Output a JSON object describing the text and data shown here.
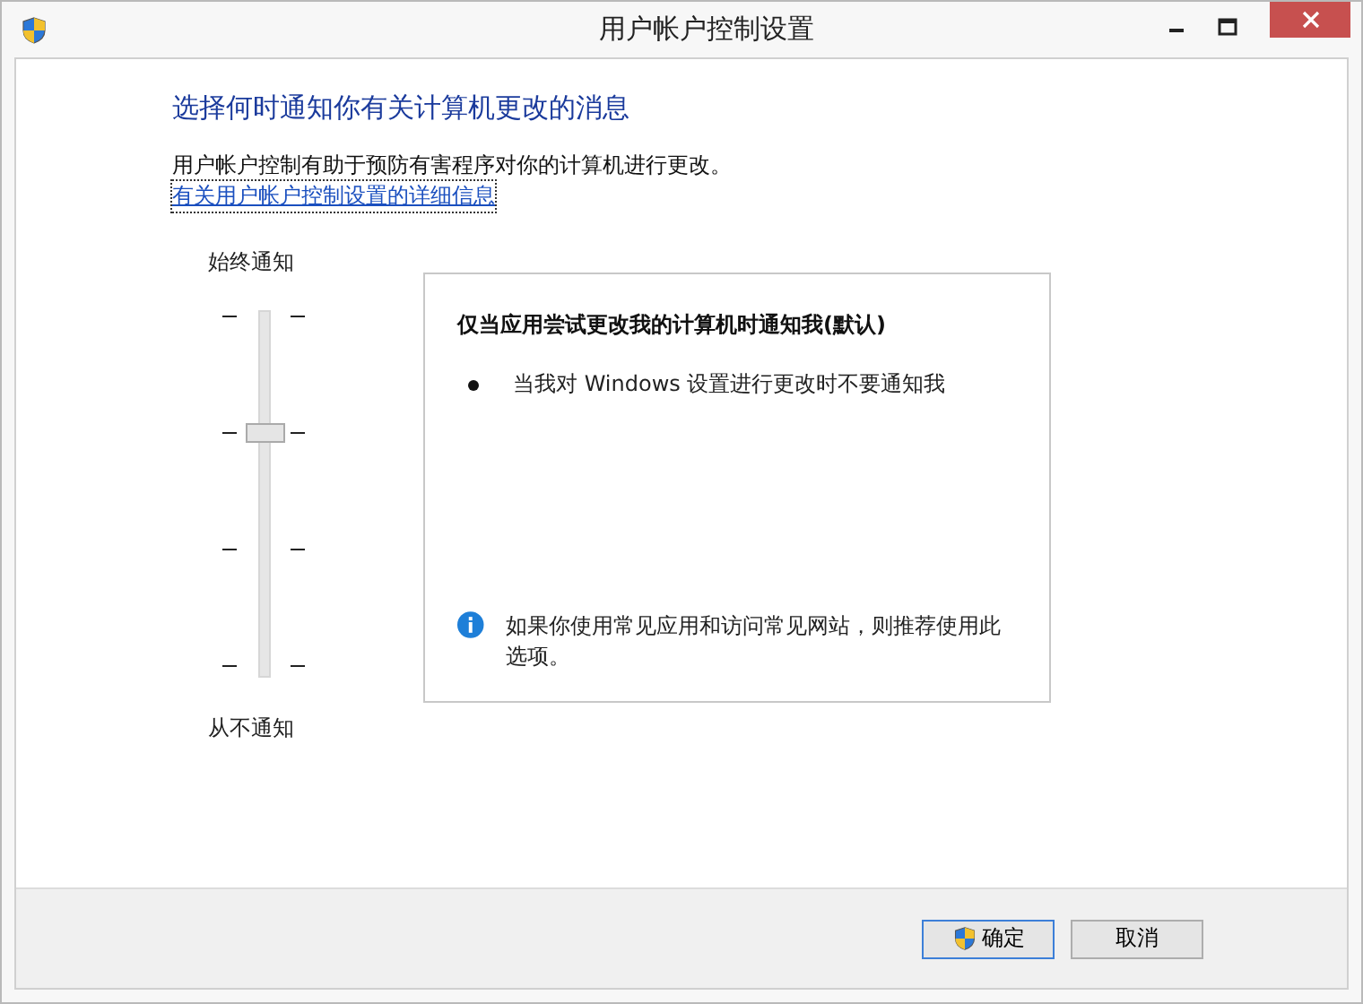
{
  "window": {
    "title": "用户帐户控制设置"
  },
  "heading": "选择何时通知你有关计算机更改的消息",
  "description": "用户帐户控制有助于预防有害程序对你的计算机进行更改。",
  "link": "有关用户帐户控制设置的详细信息",
  "slider": {
    "top_label": "始终通知",
    "bottom_label": "从不通知",
    "level": 0.667
  },
  "info": {
    "title": "仅当应用尝试更改我的计算机时通知我(默认)",
    "bullets": [
      "当我对 Windows 设置进行更改时不要通知我"
    ],
    "note": "如果你使用常见应用和访问常见网站，则推荐使用此选项。"
  },
  "buttons": [
    {
      "label": "确定",
      "kind": "shield",
      "focused": true
    },
    {
      "label": "取消",
      "kind": "plain",
      "focused": false
    }
  ]
}
